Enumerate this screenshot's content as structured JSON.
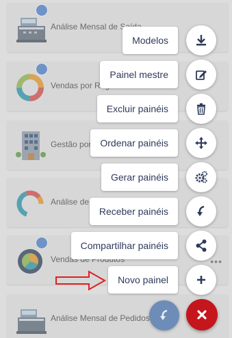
{
  "dashboards": [
    {
      "title": "Análise Mensal de Saída",
      "icon": "cash-register-icon"
    },
    {
      "title": "Vendas por Região",
      "icon": "donut-chart-icon"
    },
    {
      "title": "Gestão por",
      "icon": "building-icon"
    },
    {
      "title": "Análise de",
      "icon": "partial-donut-icon"
    },
    {
      "title": "Vendas de Produtos",
      "icon": "pie-chart-icon"
    },
    {
      "title": "Análise Mensal de Pedidos",
      "icon": "cash-register-icon"
    }
  ],
  "speed_dial": [
    {
      "label": "Modelos",
      "icon": "download-icon"
    },
    {
      "label": "Painel mestre",
      "icon": "edit-icon"
    },
    {
      "label": "Excluir painéis",
      "icon": "trash-icon"
    },
    {
      "label": "Ordenar painéis",
      "icon": "move-icon"
    },
    {
      "label": "Gerar painéis",
      "icon": "gears-icon"
    },
    {
      "label": "Receber painéis",
      "icon": "receive-arrow-icon"
    },
    {
      "label": "Compartilhar painéis",
      "icon": "share-icon"
    },
    {
      "label": "Novo painel",
      "icon": "plus-icon"
    }
  ],
  "colors": {
    "accent": "#2d3a5a",
    "close_button": "#c4161c",
    "secondary_fab": "#6d8db8",
    "arrow": "#e02020"
  }
}
